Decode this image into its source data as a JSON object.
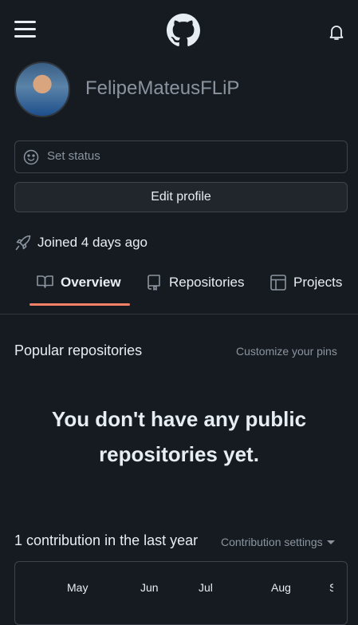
{
  "header": {
    "menu_icon": "hamburger-menu-icon",
    "logo_icon": "github-octocat-icon",
    "notifications_icon": "bell-icon"
  },
  "profile": {
    "username": "FelipeMateusFLiP",
    "avatar_icon": "user-avatar",
    "set_status_placeholder": "Set status",
    "edit_profile_label": "Edit profile",
    "joined_text": "Joined 4 days ago"
  },
  "tabs": [
    {
      "label": "Overview",
      "icon": "book-icon",
      "selected": true
    },
    {
      "label": "Repositories",
      "icon": "repo-icon",
      "selected": false
    },
    {
      "label": "Projects",
      "icon": "table-icon",
      "selected": false
    }
  ],
  "popular": {
    "title": "Popular repositories",
    "customize_label": "Customize your pins",
    "empty_line1": "You don't have any public",
    "empty_line2": "repositories yet."
  },
  "contributions": {
    "title": "1 contribution in the last year",
    "settings_label": "Contribution settings",
    "months": [
      "May",
      "Jun",
      "Jul",
      "Aug",
      "S"
    ]
  },
  "colors": {
    "background": "#161b22",
    "text": "#e6edf3",
    "muted": "#8b949e",
    "border": "#3d444d",
    "tab_accent": "#f78166"
  }
}
